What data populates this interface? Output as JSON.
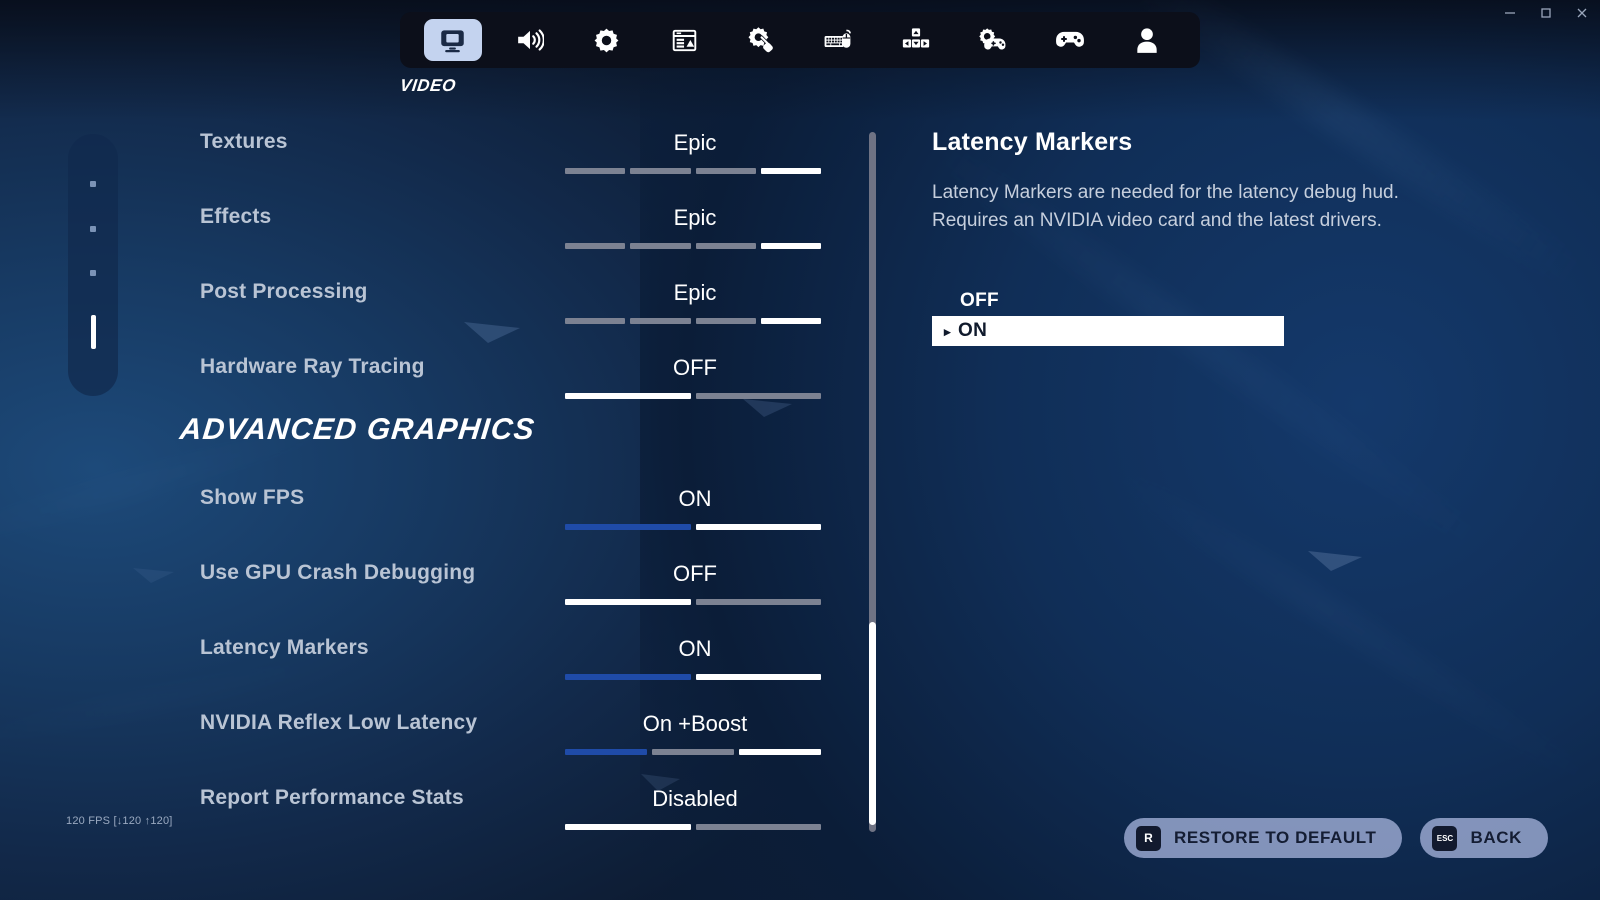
{
  "window": {
    "controls": [
      {
        "name": "minimize",
        "glyph": "minimize-icon"
      },
      {
        "name": "maximize",
        "glyph": "maximize-icon"
      },
      {
        "name": "close",
        "glyph": "close-icon"
      }
    ]
  },
  "topnav": {
    "active_label": "VIDEO",
    "items": [
      {
        "icon": "monitor-icon",
        "label": "VIDEO",
        "active": true
      },
      {
        "icon": "speaker-icon",
        "label": "AUDIO",
        "active": false
      },
      {
        "icon": "gear-icon",
        "label": "GAME",
        "active": false
      },
      {
        "icon": "hud-layout-icon",
        "label": "HUD",
        "active": false
      },
      {
        "icon": "gear-hand-icon",
        "label": "ACCESSIBILITY",
        "active": false
      },
      {
        "icon": "keyboard-mouse-icon",
        "label": "KEYBOARD CONTROLS",
        "active": false
      },
      {
        "icon": "dpad-layout-icon",
        "label": "MOVEMENT",
        "active": false
      },
      {
        "icon": "gear-gamepad-icon",
        "label": "CONTROLLER OPTIONS",
        "active": false
      },
      {
        "icon": "gamepad-icon",
        "label": "CONTROLLER",
        "active": false
      },
      {
        "icon": "person-icon",
        "label": "ACCOUNT",
        "active": false
      }
    ]
  },
  "page_indicator": {
    "dots": [
      {
        "active": false
      },
      {
        "active": false
      },
      {
        "active": false
      },
      {
        "active": true
      }
    ]
  },
  "settings": {
    "section_heading": "ADVANCED GRAPHICS",
    "rows": [
      {
        "label": "Textures",
        "value": "Epic",
        "segments": [
          "off",
          "off",
          "off",
          "on"
        ]
      },
      {
        "label": "Effects",
        "value": "Epic",
        "segments": [
          "off",
          "off",
          "off",
          "on"
        ]
      },
      {
        "label": "Post Processing",
        "value": "Epic",
        "segments": [
          "off",
          "off",
          "off",
          "on"
        ]
      },
      {
        "label": "Hardware Ray Tracing",
        "value": "OFF",
        "segments": [
          "on",
          "off"
        ]
      },
      {
        "label": "Show FPS",
        "value": "ON",
        "segments": [
          "fill",
          "on"
        ]
      },
      {
        "label": "Use GPU Crash Debugging",
        "value": "OFF",
        "segments": [
          "on",
          "off"
        ]
      },
      {
        "label": "Latency Markers",
        "value": "ON",
        "segments": [
          "fill",
          "on"
        ]
      },
      {
        "label": "NVIDIA Reflex Low Latency",
        "value": "On +Boost",
        "segments": [
          "fill",
          "off",
          "on"
        ]
      },
      {
        "label": "Report Performance Stats",
        "value": "Disabled",
        "segments": [
          "on",
          "off"
        ]
      }
    ]
  },
  "scrollbar": {
    "thumb_top_pct": 70,
    "thumb_height_pct": 29
  },
  "info": {
    "title": "Latency Markers",
    "description": "Latency Markers are needed for the latency debug hud. Requires an NVIDIA video card and the latest drivers.",
    "options": [
      {
        "label": "OFF",
        "selected": false
      },
      {
        "label": "ON",
        "selected": true
      }
    ]
  },
  "fps_counter": {
    "text": "120 FPS [↓120 ↑120]"
  },
  "actions": [
    {
      "key": "R",
      "label": "RESTORE TO DEFAULT",
      "key_small": false
    },
    {
      "key": "ESC",
      "label": "BACK",
      "key_small": true
    }
  ],
  "colors": {
    "accent_blue": "#1f4ba8",
    "nav_active_bg": "#c4d3ef",
    "selected_option_bg": "#ffffff",
    "label_gray": "#b9c4d4",
    "segment_off": "#7c8292",
    "button_bg": "rgba(176,188,228,0.72)"
  }
}
